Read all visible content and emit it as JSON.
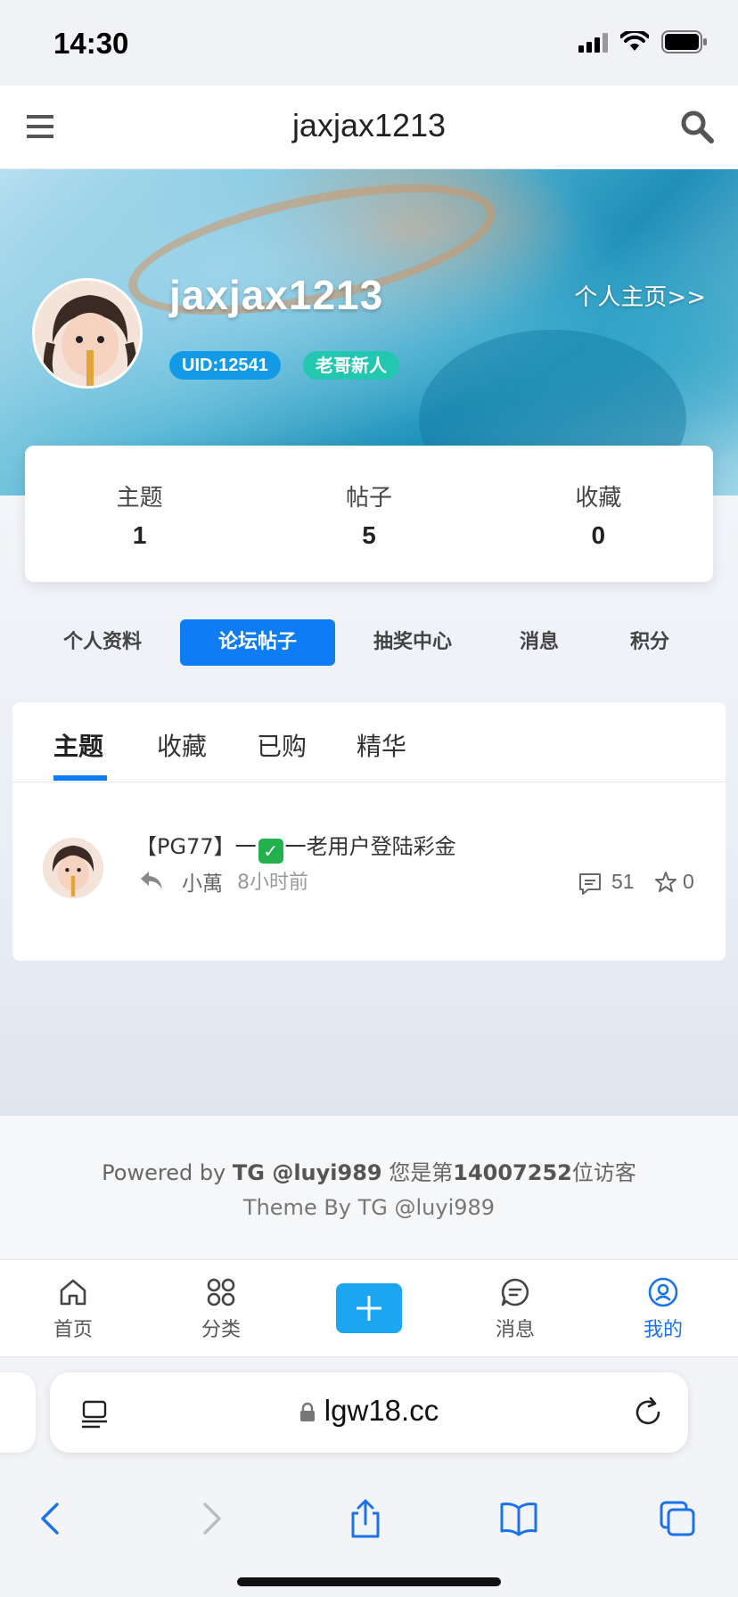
{
  "status_bar": {
    "time": "14:30"
  },
  "nav": {
    "title": "jaxjax1213",
    "menu_icon": "menu-icon",
    "search_icon": "search-icon"
  },
  "profile": {
    "username": "jaxjax1213",
    "homepage_link": "个人主页>>",
    "uid": "UID:12541",
    "rank": "老哥新人"
  },
  "stats": [
    {
      "label": "主题",
      "value": "1"
    },
    {
      "label": "帖子",
      "value": "5"
    },
    {
      "label": "收藏",
      "value": "0"
    }
  ],
  "profile_tabs": [
    {
      "label": "个人资料",
      "active": false
    },
    {
      "label": "论坛帖子",
      "active": true
    },
    {
      "label": "抽奖中心",
      "active": false
    },
    {
      "label": "消息",
      "active": false
    },
    {
      "label": "积分",
      "active": false
    }
  ],
  "sub_tabs": [
    {
      "label": "主题",
      "active": true
    },
    {
      "label": "收藏",
      "active": false
    },
    {
      "label": "已购",
      "active": false
    },
    {
      "label": "精华",
      "active": false
    }
  ],
  "posts": [
    {
      "title_prefix": "【PG77】一",
      "title_emoji": "✓",
      "title_suffix": "一老用户登陆彩金",
      "author": "小萬",
      "time": "8小时前",
      "comments": "51",
      "favorites": "0"
    }
  ],
  "footer": {
    "powered_prefix": "Powered by ",
    "powered_by": "TG @luyi989",
    "visitor_prefix": " 您是第",
    "visitor_count": "14007252",
    "visitor_suffix": "位访客",
    "theme": "Theme By TG @luyi989"
  },
  "bottom_nav": [
    {
      "label": "首页",
      "icon": "home-icon",
      "active": false
    },
    {
      "label": "分类",
      "icon": "grid-icon",
      "active": false
    },
    {
      "label": "",
      "icon": "plus-icon",
      "active": false
    },
    {
      "label": "消息",
      "icon": "chat-icon",
      "active": false
    },
    {
      "label": "我的",
      "icon": "user-circle-icon",
      "active": true
    }
  ],
  "browser": {
    "url": "lgw18.cc"
  },
  "colors": {
    "accent": "#0e7cf2",
    "uid_badge": "#139ae6",
    "rank_badge": "#23c7b0",
    "plus_button": "#1aa6f0"
  }
}
